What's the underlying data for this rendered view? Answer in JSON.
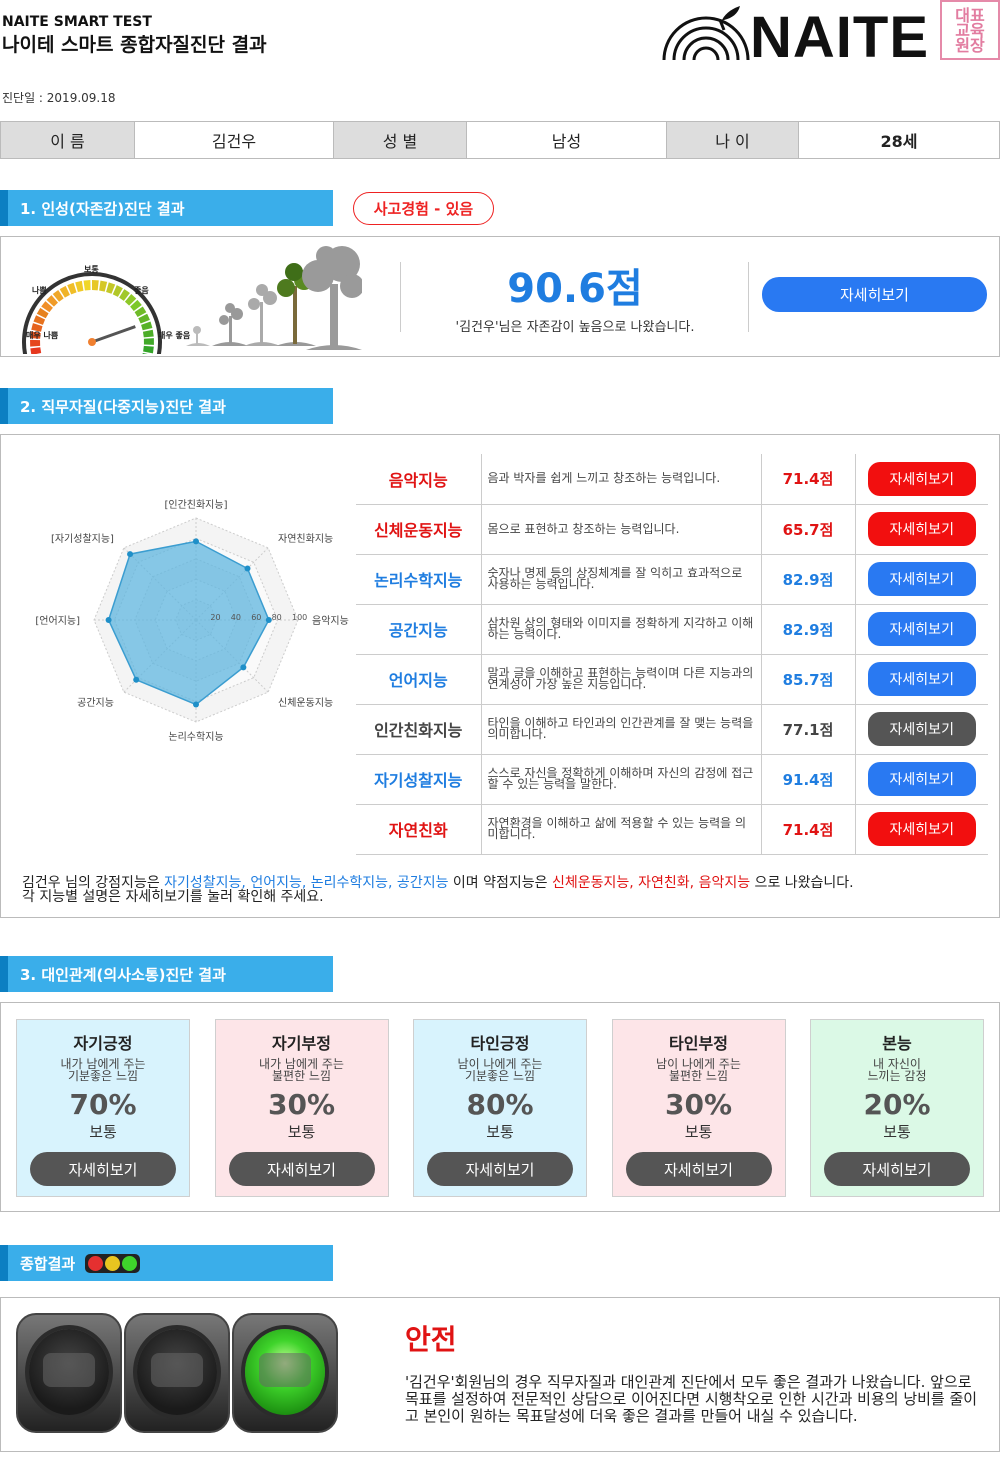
{
  "header": {
    "brand_sub": "NAITE SMART TEST",
    "title": "나이테 스마트 종합자질진단 결과",
    "logo_text": "NAITE",
    "seal_text": "대표교육원장",
    "date": "진단일 : 2019.09.18"
  },
  "profile": {
    "name_label": "이 름",
    "name": "김건우",
    "gender_label": "성 별",
    "gender": "남성",
    "age_label": "나 이",
    "age": "28세"
  },
  "section1": {
    "heading": "1. 인성(자존감)진단 결과",
    "accident_badge": "사고경험 - 있음",
    "gauge_labels": [
      "매우 나쁨",
      "나쁨",
      "보통",
      "좋음",
      "매우 좋음"
    ],
    "score": "90.6점",
    "description": "'김건우'님은 자존감이 높음으로 나왔습니다.",
    "detail_button": "자세히보기",
    "gauge_level": 0.82
  },
  "section2": {
    "heading": "2. 직무자질(다중지능)진단 결과",
    "radar_labels": [
      "[인간친화지능]",
      "자연친화지능",
      "음악지능",
      "신체운동지능",
      "논리수학지능",
      "공간지능",
      "[언어지능]",
      "[자기성찰지능]"
    ],
    "radar_values": [
      77.1,
      71.4,
      71.4,
      65.7,
      82.9,
      82.9,
      85.7,
      91.4
    ],
    "radar_ticks": [
      "20",
      "40",
      "60",
      "80",
      "100"
    ],
    "rows": [
      {
        "name": "음악지능",
        "desc": "음과 박자를 쉽게 느끼고 창조하는 능력입니다.",
        "score": "71.4점",
        "tone": "red",
        "button": "자세히보기"
      },
      {
        "name": "신체운동지능",
        "desc": "몸으로 표현하고 창조하는 능력입니다.",
        "score": "65.7점",
        "tone": "red",
        "button": "자세히보기"
      },
      {
        "name": "논리수학지능",
        "desc": "숫자나 명제 등의 상징체계를 잘 익히고 효과적으로 사용하는 능력입니다.",
        "score": "82.9점",
        "tone": "blue",
        "button": "자세히보기"
      },
      {
        "name": "공간지능",
        "desc": "삼차원 상의 형태와 이미지를 정확하게 지각하고 이해하는 능력이다.",
        "score": "82.9점",
        "tone": "blue",
        "button": "자세히보기"
      },
      {
        "name": "언어지능",
        "desc": "말과 글을 이해하고 표현하는 능력이며 다른 지능과의 연계성이 가장 높은 지능입니다.",
        "score": "85.7점",
        "tone": "blue",
        "button": "자세히보기"
      },
      {
        "name": "인간친화지능",
        "desc": "타인을 이해하고 타인과의 인간관계를 잘 맺는 능력을 의미합니다.",
        "score": "77.1점",
        "tone": "dark",
        "button": "자세히보기"
      },
      {
        "name": "자기성찰지능",
        "desc": "스스로 자신을 정확하게 이해하며 자신의 감정에 접근할 수 있는 능력을 말한다.",
        "score": "91.4점",
        "tone": "blue",
        "button": "자세히보기"
      },
      {
        "name": "자연친화",
        "desc": "자연환경을 이해하고 삶에 적용할 수 있는 능력을 의미합니다.",
        "score": "71.4점",
        "tone": "red",
        "button": "자세히보기"
      }
    ],
    "summary_pre": "김건우 님의 강점지능은 ",
    "summary_strong": "자기성찰지능, 언어지능, 논리수학지능, 공간지능",
    "summary_mid": " 이며 약점지능은 ",
    "summary_weak": "신체운동지능, 자연친화, 음악지능",
    "summary_post": " 으로 나왔습니다.",
    "summary_line2": "각 지능별 설명은 자세히보기를 눌러 확인해 주세요."
  },
  "section3": {
    "heading": "3. 대인관계(의사소통)진단 결과",
    "cards": [
      {
        "title": "자기긍정",
        "desc1": "내가 남에게 주는",
        "desc2": "기분좋은 느낌",
        "percent": "70%",
        "level": "보통",
        "button": "자세히보기",
        "bg": "#d8f3fd"
      },
      {
        "title": "자기부정",
        "desc1": "내가 남에게 주는",
        "desc2": "불편한 느낌",
        "percent": "30%",
        "level": "보통",
        "button": "자세히보기",
        "bg": "#fde5e8"
      },
      {
        "title": "타인긍정",
        "desc1": "남이 나에게 주는",
        "desc2": "기분좋은 느낌",
        "percent": "80%",
        "level": "보통",
        "button": "자세히보기",
        "bg": "#d8f3fd"
      },
      {
        "title": "타인부정",
        "desc1": "남이 나에게 주는",
        "desc2": "불편한 느낌",
        "percent": "30%",
        "level": "보통",
        "button": "자세히보기",
        "bg": "#fde5e8"
      },
      {
        "title": "본능",
        "desc1": "내 자신이",
        "desc2": "느끼는 감정",
        "percent": "20%",
        "level": "보통",
        "button": "자세히보기",
        "bg": "#dbf9e6"
      }
    ]
  },
  "section4": {
    "heading": "종합결과",
    "result": "안전",
    "description": "'김건우'회원님의 경우 직무자질과 대인관계 진단에서 모두 좋은 결과가 나왔습니다. 앞으로 목표를 설정하여 전문적인 상담으로 이어진다면 시행착오로 인한 시간과 비용의 낭비를 줄이고 본인이 원하는 목표달성에 더욱 좋은 결과를 만들어 내실 수 있습니다."
  },
  "colors": {
    "accent": "#3aaeea",
    "red": "#f20f0f",
    "blue": "#2979f2",
    "dark": "#555555",
    "green": "#3fd42b"
  }
}
